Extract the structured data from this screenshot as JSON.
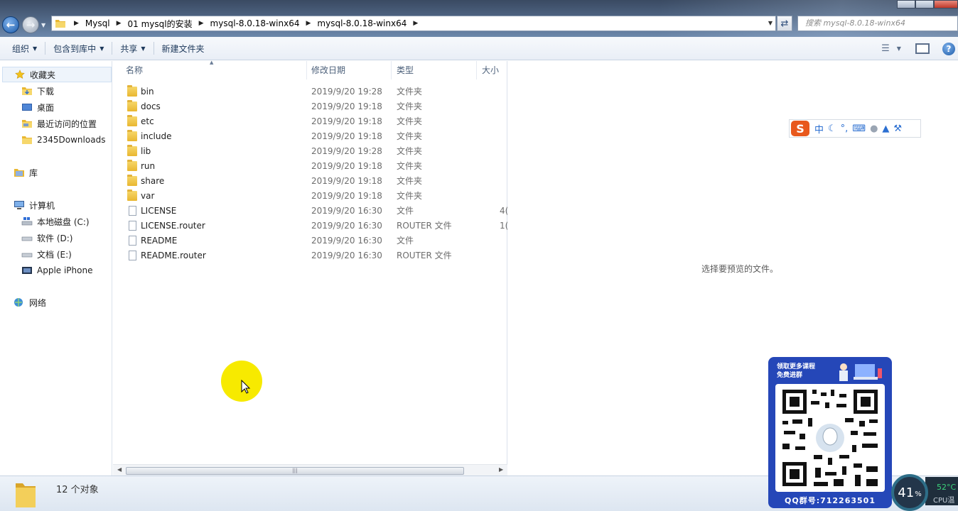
{
  "address_bar": {
    "crumbs": [
      "Mysql",
      "01 mysql的安装",
      "mysql-8.0.18-winx64",
      "mysql-8.0.18-winx64"
    ],
    "search_placeholder": "搜索 mysql-8.0.18-winx64"
  },
  "toolbar": {
    "organize": "组织",
    "include_in_library": "包含到库中",
    "share": "共享",
    "new_folder": "新建文件夹"
  },
  "nav": {
    "favorites": "收藏夹",
    "downloads": "下载",
    "desktop": "桌面",
    "recent_places": "最近访问的位置",
    "downloads_2345": "2345Downloads",
    "libraries": "库",
    "computer": "计算机",
    "drive_c": "本地磁盘 (C:)",
    "drive_d": "软件 (D:)",
    "drive_e": "文档 (E:)",
    "apple_iphone": "Apple iPhone",
    "network": "网络"
  },
  "columns": {
    "name": "名称",
    "date_modified": "修改日期",
    "type": "类型",
    "size": "大小"
  },
  "files": [
    {
      "name": "bin",
      "date": "2019/9/20 19:28",
      "type": "文件夹",
      "size": "",
      "kind": "folder"
    },
    {
      "name": "docs",
      "date": "2019/9/20 19:18",
      "type": "文件夹",
      "size": "",
      "kind": "folder"
    },
    {
      "name": "etc",
      "date": "2019/9/20 19:18",
      "type": "文件夹",
      "size": "",
      "kind": "folder"
    },
    {
      "name": "include",
      "date": "2019/9/20 19:18",
      "type": "文件夹",
      "size": "",
      "kind": "folder"
    },
    {
      "name": "lib",
      "date": "2019/9/20 19:28",
      "type": "文件夹",
      "size": "",
      "kind": "folder"
    },
    {
      "name": "run",
      "date": "2019/9/20 19:18",
      "type": "文件夹",
      "size": "",
      "kind": "folder"
    },
    {
      "name": "share",
      "date": "2019/9/20 19:18",
      "type": "文件夹",
      "size": "",
      "kind": "folder"
    },
    {
      "name": "var",
      "date": "2019/9/20 19:18",
      "type": "文件夹",
      "size": "",
      "kind": "folder"
    },
    {
      "name": "LICENSE",
      "date": "2019/9/20 16:30",
      "type": "文件",
      "size": "4(",
      "kind": "file"
    },
    {
      "name": "LICENSE.router",
      "date": "2019/9/20 16:30",
      "type": "ROUTER 文件",
      "size": "1(",
      "kind": "file"
    },
    {
      "name": "README",
      "date": "2019/9/20 16:30",
      "type": "文件",
      "size": "",
      "kind": "file"
    },
    {
      "name": "README.router",
      "date": "2019/9/20 16:30",
      "type": "ROUTER 文件",
      "size": "",
      "kind": "file"
    }
  ],
  "preview": {
    "message": "选择要预览的文件。"
  },
  "status": {
    "count": "12 个对象"
  },
  "ime": {
    "logo": "S",
    "mode": "中"
  },
  "qr_overlay": {
    "headline_1": "领取更多课程",
    "headline_2": "免费进群",
    "footer": "QQ群号:712263501"
  },
  "cpu_widget": {
    "percent": "41",
    "percent_sign": "%",
    "temperature": "52°C",
    "label": "CPU温"
  },
  "colors": {
    "accent": "#1c5aa8",
    "qr_bg": "#2547b8",
    "cursor_highlight": "#f7ea00"
  }
}
